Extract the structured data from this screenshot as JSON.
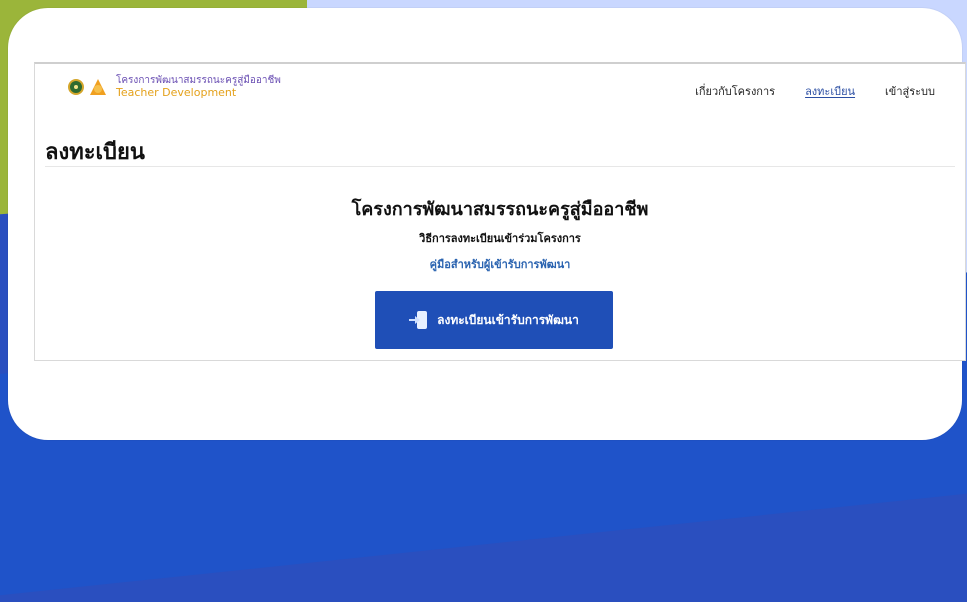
{
  "brand": {
    "thai": "โครงการพัฒนาสมรรถนะครูสู่มืออาชีพ",
    "english": "Teacher Development"
  },
  "nav": {
    "items": [
      {
        "label": "เกี่ยวกับโครงการ",
        "active": false
      },
      {
        "label": "ลงทะเบียน",
        "active": true
      },
      {
        "label": "เข้าสู่ระบบ",
        "active": false
      }
    ]
  },
  "page": {
    "title": "ลงทะเบียน",
    "project_title": "โครงการพัฒนาสมรรถนะครูสู่มืออาชีพ",
    "subtitle": "วิธีการลงทะเบียนเข้าร่วมโครงการ",
    "manual_link": "คู่มือสำหรับผู้เข้ารับการพัฒนา",
    "register_button": "ลงทะเบียนเข้ารับการพัฒนา"
  },
  "colors": {
    "primary": "#1f4fb7",
    "link": "#2a63b0",
    "brand_purple": "#6a4fb3",
    "brand_orange": "#e4a11b",
    "bg_green": "#9bb53a",
    "bg_blue": "#1f53c9"
  },
  "icons": {
    "emblem": "school-emblem-icon",
    "flame": "torch-logo-icon",
    "login": "login-arrow-icon"
  }
}
